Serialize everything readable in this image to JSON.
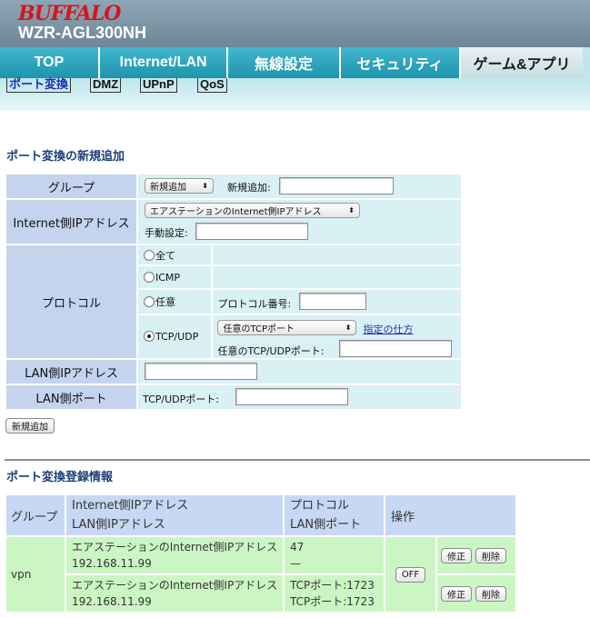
{
  "header": {
    "logo": "BUFFALO",
    "model": "WZR-AGL300NH"
  },
  "tabs": [
    {
      "label": "TOP"
    },
    {
      "label": "Internet/LAN"
    },
    {
      "label": "無線設定"
    },
    {
      "label": "セキュリティ"
    },
    {
      "label": "ゲーム&アプリ",
      "active": true
    }
  ],
  "subtabs": [
    {
      "label": "ポート変換",
      "active": true
    },
    {
      "label": "DMZ"
    },
    {
      "label": "UPnP"
    },
    {
      "label": "QoS"
    }
  ],
  "new_entry": {
    "title": "ポート変換の新規追加",
    "group": {
      "label": "グループ",
      "select": "新規追加",
      "new_label": "新規追加:",
      "new_value": ""
    },
    "internet_ip": {
      "label": "Internet側IPアドレス",
      "select": "エアステーションのInternet側IPアドレス",
      "manual_label": "手動設定:",
      "manual_value": ""
    },
    "protocol": {
      "label": "プロトコル",
      "options": [
        {
          "label": "全て",
          "selected": false
        },
        {
          "label": "ICMP",
          "selected": false
        },
        {
          "label": "任意",
          "selected": false
        },
        {
          "label": "TCP/UDP",
          "selected": true
        }
      ],
      "proto_num_label": "プロトコル番号:",
      "proto_num_value": "",
      "port_select": "任意のTCPポート",
      "howto_link": "指定の仕方",
      "port_label": "任意のTCP/UDPポート:",
      "port_value": ""
    },
    "lan_ip": {
      "label": "LAN側IPアドレス",
      "value": ""
    },
    "lan_port": {
      "label": "LAN側ポート",
      "port_label": "TCP/UDPポート:",
      "value": ""
    },
    "add_button": "新規追加"
  },
  "registered": {
    "title": "ポート変換登録情報",
    "headers": {
      "group": "グループ",
      "ip_line1": "Internet側IPアドレス",
      "ip_line2": "LAN側IPアドレス",
      "proto_line1": "プロトコル",
      "proto_line2": "LAN側ポート",
      "action": "操作"
    },
    "group": "vpn",
    "toggle": "OFF",
    "rows": [
      {
        "internet_ip": "エアステーションのInternet側IPアドレス",
        "lan_ip": "192.168.11.99",
        "protocol": "47",
        "lan_port": "—",
        "edit": "修正",
        "delete": "削除"
      },
      {
        "internet_ip": "エアステーションのInternet側IPアドレス",
        "lan_ip": "192.168.11.99",
        "protocol": "TCPポート:1723",
        "lan_port": "TCPポート:1723",
        "edit": "修正",
        "delete": "削除"
      }
    ]
  }
}
